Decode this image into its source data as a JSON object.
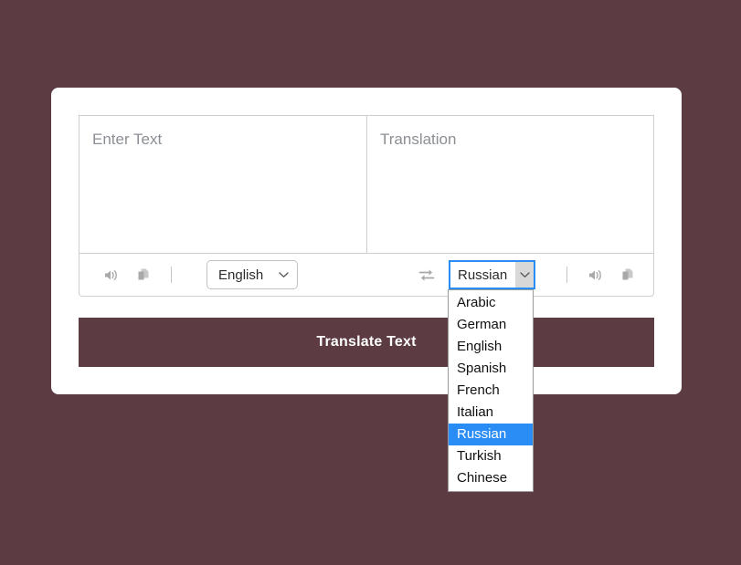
{
  "theme": {
    "page_background": "#5c3b43",
    "card_background": "#ffffff",
    "accent": "#5c3b43",
    "highlight": "#2a8cf5",
    "focus_outline": "#2a8cf5",
    "border": "#cfcfcf",
    "placeholder_text": "#8b8f94"
  },
  "editor": {
    "source": {
      "placeholder": "Enter Text",
      "value": ""
    },
    "target": {
      "placeholder": "Translation",
      "value": ""
    }
  },
  "toolbar": {
    "source": {
      "speak_icon": "speaker-icon",
      "copy_icon": "copy-icon",
      "language_selected": "English",
      "language_options": [
        "Arabic",
        "German",
        "English",
        "Spanish",
        "French",
        "Italian",
        "Russian",
        "Turkish",
        "Chinese"
      ]
    },
    "swap_icon": "swap-arrows-icon",
    "target": {
      "speak_icon": "speaker-icon",
      "copy_icon": "copy-icon",
      "language_selected": "Russian",
      "language_options": [
        "Arabic",
        "German",
        "English",
        "Spanish",
        "French",
        "Italian",
        "Russian",
        "Turkish",
        "Chinese"
      ]
    }
  },
  "dropdown": {
    "open": true,
    "selected": "Russian",
    "options": [
      "Arabic",
      "German",
      "English",
      "Spanish",
      "French",
      "Italian",
      "Russian",
      "Turkish",
      "Chinese"
    ]
  },
  "actions": {
    "translate_label": "Translate Text"
  }
}
